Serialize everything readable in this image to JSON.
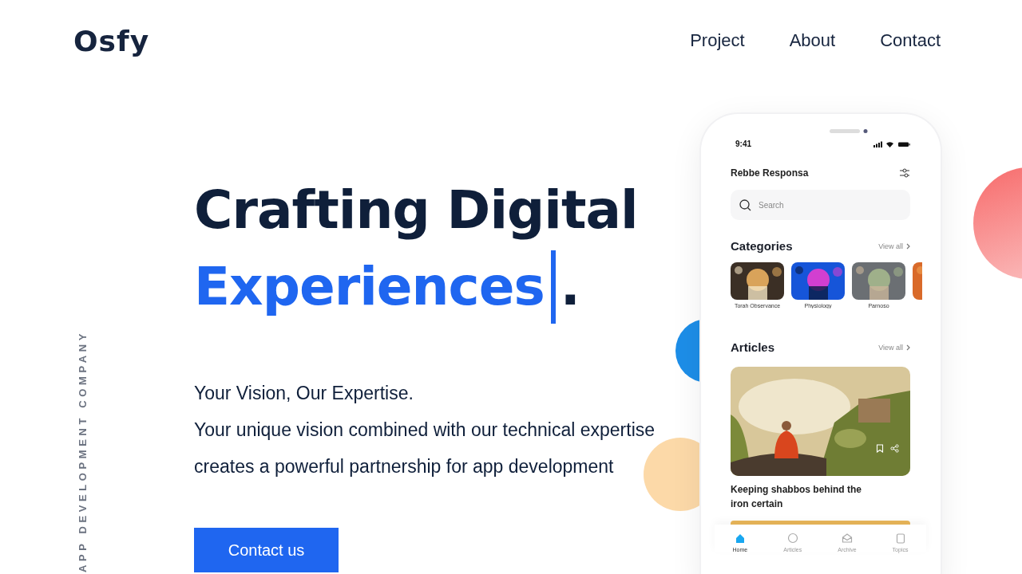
{
  "header": {
    "logo": "Osfy",
    "nav": [
      {
        "label": "Project"
      },
      {
        "label": "About"
      },
      {
        "label": "Contact"
      }
    ]
  },
  "side_label": "APP DEVELOPMENT COMPANY",
  "hero": {
    "headline_line1": "Crafting Digital",
    "headline_line2": "Experiences",
    "headline_end": ".",
    "tagline": "Your Vision, Our Expertise.",
    "description": "Your unique vision combined with our technical expertise creates a powerful partnership for app development",
    "cta": "Contact us"
  },
  "phone": {
    "time": "9:41",
    "app_title": "Rebbe Responsa",
    "search": {
      "placeholder": "Search"
    },
    "categories": {
      "title": "Categories",
      "view_all": "View all",
      "items": [
        {
          "label": "Torah Observance"
        },
        {
          "label": "Physiology"
        },
        {
          "label": "Parnoso"
        }
      ]
    },
    "articles": {
      "title": "Articles",
      "view_all": "View all",
      "items": [
        {
          "title": "Keeping shabbos behind the iron certain"
        }
      ]
    },
    "bottom_nav": [
      {
        "label": "Home",
        "selected": true
      },
      {
        "label": "Articles",
        "selected": false
      },
      {
        "label": "Archive",
        "selected": false
      },
      {
        "label": "Topics",
        "selected": false
      }
    ]
  }
}
